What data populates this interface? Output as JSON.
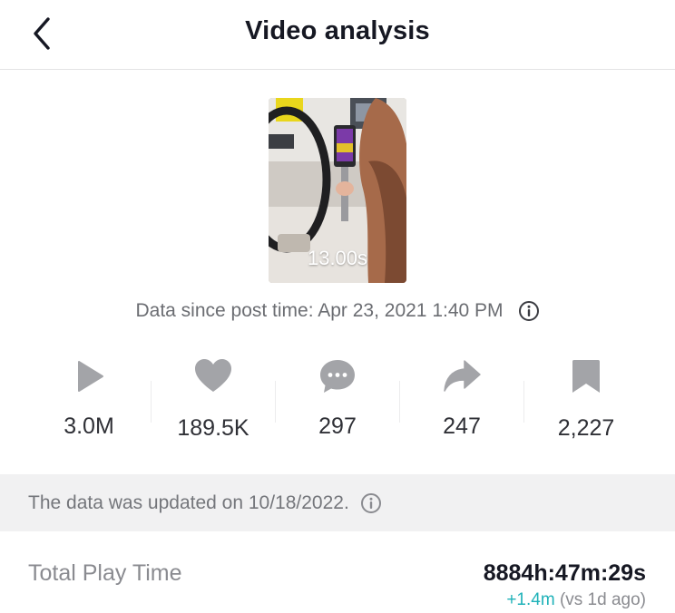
{
  "header": {
    "title": "Video analysis",
    "back_icon": "chevron-left-icon"
  },
  "video": {
    "duration": "13.00s"
  },
  "post_time": {
    "text": "Data since post time: Apr 23, 2021 1:40 PM",
    "info_icon": "info-icon"
  },
  "stats": [
    {
      "icon": "play-icon",
      "value": "3.0M"
    },
    {
      "icon": "heart-icon",
      "value": "189.5K"
    },
    {
      "icon": "comment-icon",
      "value": "297"
    },
    {
      "icon": "share-icon",
      "value": "247"
    },
    {
      "icon": "bookmark-icon",
      "value": "2,227"
    }
  ],
  "update_banner": {
    "text": "The data was updated on 10/18/2022.",
    "info_icon": "info-icon"
  },
  "total_play_time": {
    "label": "Total Play Time",
    "value": "8884h:47m:29s",
    "change": "+1.4m",
    "compare": "(vs 1d ago)"
  },
  "colors": {
    "icon_gray": "#a3a4a8",
    "accent_teal": "#20b2b9",
    "banner_bg": "#f1f1f2"
  }
}
